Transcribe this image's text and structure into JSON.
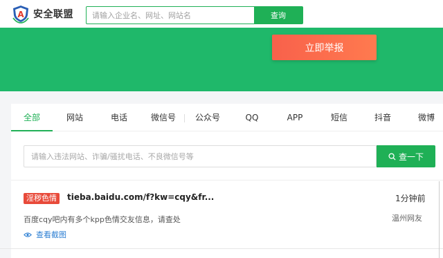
{
  "header": {
    "logo_text": "安全联盟",
    "search_placeholder": "请输入企业名、网址、网站名",
    "search_button": "查询"
  },
  "hero": {
    "report_button": "立即举报"
  },
  "tabs": [
    {
      "label": "全部",
      "active": true
    },
    {
      "label": "网站"
    },
    {
      "label": "电话"
    },
    {
      "label": "微信号"
    },
    {
      "label": "公众号"
    },
    {
      "label": "QQ"
    },
    {
      "label": "APP"
    },
    {
      "label": "短信"
    },
    {
      "label": "抖音"
    },
    {
      "label": "微博"
    }
  ],
  "filter": {
    "placeholder": "请输入违法网站、诈骗/骚扰电话、不良微信号等",
    "button": "查一下"
  },
  "items": [
    {
      "tag": "淫秽色情",
      "url": "tieba.baidu.com/f?kw=cqy&fr...",
      "time": "1分钟前",
      "desc": "百度cqy吧内有多个kpp色情交友信息，请查处",
      "user": "温州网友",
      "view_link": "查看截图"
    }
  ],
  "colors": {
    "brand_green": "#1fb056",
    "hero_green": "#1fb86a",
    "report_orange": "#f8614b",
    "tag_red": "#e84a3a",
    "link_blue": "#2d7fd3"
  }
}
